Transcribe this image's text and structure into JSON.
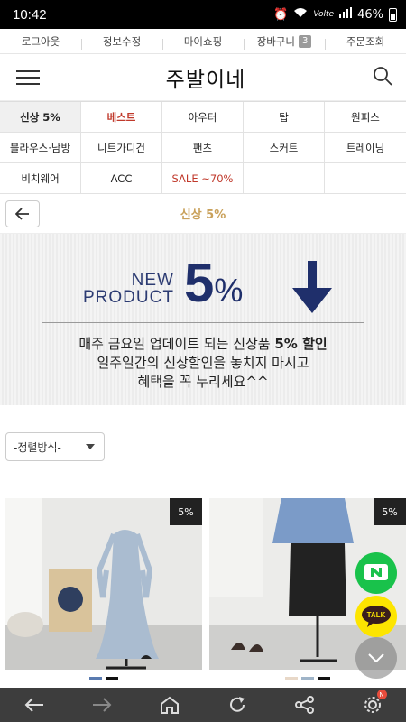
{
  "status": {
    "time": "10:42",
    "battery": "46%",
    "network": "Volte"
  },
  "topnav": {
    "items": [
      "로그아웃",
      "정보수정",
      "마이쇼핑",
      "장바구니",
      "주문조회"
    ],
    "cart_count": "3"
  },
  "header": {
    "logo": "주발이네"
  },
  "categories": [
    "신상 5%",
    "베스트",
    "아우터",
    "탑",
    "원피스",
    "블라우스·남방",
    "니트가디건",
    "팬츠",
    "스커트",
    "트레이닝",
    "비치웨어",
    "ACC",
    "SALE ~70%",
    ""
  ],
  "page": {
    "title": "신상 5%"
  },
  "banner": {
    "new": "NEW",
    "product": "PRODUCT",
    "percent_num": "5",
    "percent_sign": "%",
    "line1_a": "매주 금요일 업데이트 되는 신상품 ",
    "line1_b": "5% 할인",
    "line2": "일주일간의 신상할인을 놓치지 마시고",
    "line3": "혜택을 꼭 누리세요^^"
  },
  "sort": {
    "label": "-정렬방식-"
  },
  "products": [
    {
      "tag": "5%",
      "swatches": [
        "#5a7bb0",
        "#111111"
      ]
    },
    {
      "tag": "5%",
      "swatches": [
        "#e8d8c8",
        "#9fb4c8",
        "#111111"
      ]
    }
  ],
  "fab": {
    "talk": "TALK"
  },
  "settings_badge": "N"
}
